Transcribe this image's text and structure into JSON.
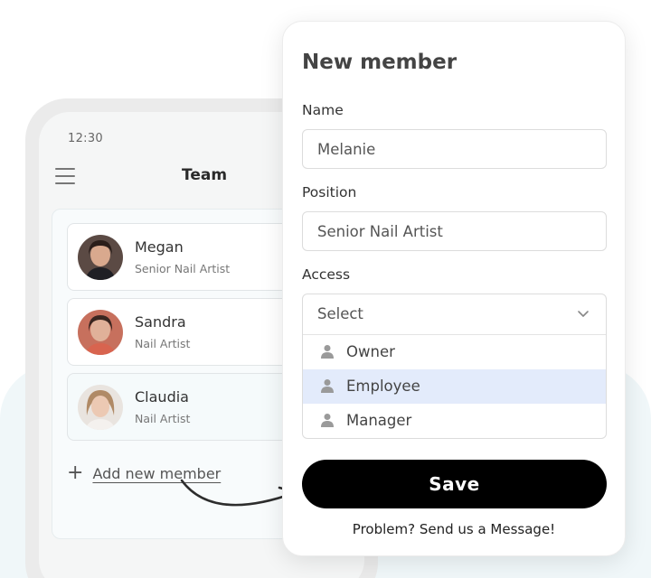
{
  "status_bar": {
    "time": "12:30"
  },
  "app": {
    "title": "Team"
  },
  "members": [
    {
      "name": "Megan",
      "role": "Senior Nail Artist"
    },
    {
      "name": "Sandra",
      "role": "Nail Artist"
    },
    {
      "name": "Claudia",
      "role": "Nail Artist"
    }
  ],
  "add_member_label": "Add new member",
  "form": {
    "title": "New member",
    "name": {
      "label": "Name",
      "value": "Melanie"
    },
    "position": {
      "label": "Position",
      "value": "Senior Nail Artist"
    },
    "access": {
      "label": "Access",
      "value": "Select",
      "options": [
        "Owner",
        "Employee",
        "Manager"
      ],
      "highlighted": "Employee"
    },
    "save_label": "Save",
    "help_text": "Problem? Send us a Message!"
  },
  "icons": [
    "menu-icon",
    "chevron-down-icon",
    "person-icon",
    "plus-icon",
    "curved-arrow-icon"
  ]
}
